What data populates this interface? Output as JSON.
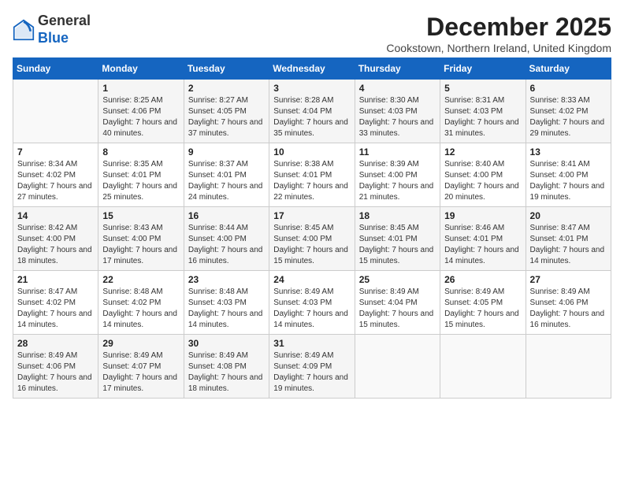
{
  "logo": {
    "general": "General",
    "blue": "Blue"
  },
  "header": {
    "month": "December 2025",
    "location": "Cookstown, Northern Ireland, United Kingdom"
  },
  "weekdays": [
    "Sunday",
    "Monday",
    "Tuesday",
    "Wednesday",
    "Thursday",
    "Friday",
    "Saturday"
  ],
  "weeks": [
    [
      {
        "day": "",
        "sunrise": "",
        "sunset": "",
        "daylight": ""
      },
      {
        "day": "1",
        "sunrise": "Sunrise: 8:25 AM",
        "sunset": "Sunset: 4:06 PM",
        "daylight": "Daylight: 7 hours and 40 minutes."
      },
      {
        "day": "2",
        "sunrise": "Sunrise: 8:27 AM",
        "sunset": "Sunset: 4:05 PM",
        "daylight": "Daylight: 7 hours and 37 minutes."
      },
      {
        "day": "3",
        "sunrise": "Sunrise: 8:28 AM",
        "sunset": "Sunset: 4:04 PM",
        "daylight": "Daylight: 7 hours and 35 minutes."
      },
      {
        "day": "4",
        "sunrise": "Sunrise: 8:30 AM",
        "sunset": "Sunset: 4:03 PM",
        "daylight": "Daylight: 7 hours and 33 minutes."
      },
      {
        "day": "5",
        "sunrise": "Sunrise: 8:31 AM",
        "sunset": "Sunset: 4:03 PM",
        "daylight": "Daylight: 7 hours and 31 minutes."
      },
      {
        "day": "6",
        "sunrise": "Sunrise: 8:33 AM",
        "sunset": "Sunset: 4:02 PM",
        "daylight": "Daylight: 7 hours and 29 minutes."
      }
    ],
    [
      {
        "day": "7",
        "sunrise": "Sunrise: 8:34 AM",
        "sunset": "Sunset: 4:02 PM",
        "daylight": "Daylight: 7 hours and 27 minutes."
      },
      {
        "day": "8",
        "sunrise": "Sunrise: 8:35 AM",
        "sunset": "Sunset: 4:01 PM",
        "daylight": "Daylight: 7 hours and 25 minutes."
      },
      {
        "day": "9",
        "sunrise": "Sunrise: 8:37 AM",
        "sunset": "Sunset: 4:01 PM",
        "daylight": "Daylight: 7 hours and 24 minutes."
      },
      {
        "day": "10",
        "sunrise": "Sunrise: 8:38 AM",
        "sunset": "Sunset: 4:01 PM",
        "daylight": "Daylight: 7 hours and 22 minutes."
      },
      {
        "day": "11",
        "sunrise": "Sunrise: 8:39 AM",
        "sunset": "Sunset: 4:00 PM",
        "daylight": "Daylight: 7 hours and 21 minutes."
      },
      {
        "day": "12",
        "sunrise": "Sunrise: 8:40 AM",
        "sunset": "Sunset: 4:00 PM",
        "daylight": "Daylight: 7 hours and 20 minutes."
      },
      {
        "day": "13",
        "sunrise": "Sunrise: 8:41 AM",
        "sunset": "Sunset: 4:00 PM",
        "daylight": "Daylight: 7 hours and 19 minutes."
      }
    ],
    [
      {
        "day": "14",
        "sunrise": "Sunrise: 8:42 AM",
        "sunset": "Sunset: 4:00 PM",
        "daylight": "Daylight: 7 hours and 18 minutes."
      },
      {
        "day": "15",
        "sunrise": "Sunrise: 8:43 AM",
        "sunset": "Sunset: 4:00 PM",
        "daylight": "Daylight: 7 hours and 17 minutes."
      },
      {
        "day": "16",
        "sunrise": "Sunrise: 8:44 AM",
        "sunset": "Sunset: 4:00 PM",
        "daylight": "Daylight: 7 hours and 16 minutes."
      },
      {
        "day": "17",
        "sunrise": "Sunrise: 8:45 AM",
        "sunset": "Sunset: 4:00 PM",
        "daylight": "Daylight: 7 hours and 15 minutes."
      },
      {
        "day": "18",
        "sunrise": "Sunrise: 8:45 AM",
        "sunset": "Sunset: 4:01 PM",
        "daylight": "Daylight: 7 hours and 15 minutes."
      },
      {
        "day": "19",
        "sunrise": "Sunrise: 8:46 AM",
        "sunset": "Sunset: 4:01 PM",
        "daylight": "Daylight: 7 hours and 14 minutes."
      },
      {
        "day": "20",
        "sunrise": "Sunrise: 8:47 AM",
        "sunset": "Sunset: 4:01 PM",
        "daylight": "Daylight: 7 hours and 14 minutes."
      }
    ],
    [
      {
        "day": "21",
        "sunrise": "Sunrise: 8:47 AM",
        "sunset": "Sunset: 4:02 PM",
        "daylight": "Daylight: 7 hours and 14 minutes."
      },
      {
        "day": "22",
        "sunrise": "Sunrise: 8:48 AM",
        "sunset": "Sunset: 4:02 PM",
        "daylight": "Daylight: 7 hours and 14 minutes."
      },
      {
        "day": "23",
        "sunrise": "Sunrise: 8:48 AM",
        "sunset": "Sunset: 4:03 PM",
        "daylight": "Daylight: 7 hours and 14 minutes."
      },
      {
        "day": "24",
        "sunrise": "Sunrise: 8:49 AM",
        "sunset": "Sunset: 4:03 PM",
        "daylight": "Daylight: 7 hours and 14 minutes."
      },
      {
        "day": "25",
        "sunrise": "Sunrise: 8:49 AM",
        "sunset": "Sunset: 4:04 PM",
        "daylight": "Daylight: 7 hours and 15 minutes."
      },
      {
        "day": "26",
        "sunrise": "Sunrise: 8:49 AM",
        "sunset": "Sunset: 4:05 PM",
        "daylight": "Daylight: 7 hours and 15 minutes."
      },
      {
        "day": "27",
        "sunrise": "Sunrise: 8:49 AM",
        "sunset": "Sunset: 4:06 PM",
        "daylight": "Daylight: 7 hours and 16 minutes."
      }
    ],
    [
      {
        "day": "28",
        "sunrise": "Sunrise: 8:49 AM",
        "sunset": "Sunset: 4:06 PM",
        "daylight": "Daylight: 7 hours and 16 minutes."
      },
      {
        "day": "29",
        "sunrise": "Sunrise: 8:49 AM",
        "sunset": "Sunset: 4:07 PM",
        "daylight": "Daylight: 7 hours and 17 minutes."
      },
      {
        "day": "30",
        "sunrise": "Sunrise: 8:49 AM",
        "sunset": "Sunset: 4:08 PM",
        "daylight": "Daylight: 7 hours and 18 minutes."
      },
      {
        "day": "31",
        "sunrise": "Sunrise: 8:49 AM",
        "sunset": "Sunset: 4:09 PM",
        "daylight": "Daylight: 7 hours and 19 minutes."
      },
      {
        "day": "",
        "sunrise": "",
        "sunset": "",
        "daylight": ""
      },
      {
        "day": "",
        "sunrise": "",
        "sunset": "",
        "daylight": ""
      },
      {
        "day": "",
        "sunrise": "",
        "sunset": "",
        "daylight": ""
      }
    ]
  ]
}
